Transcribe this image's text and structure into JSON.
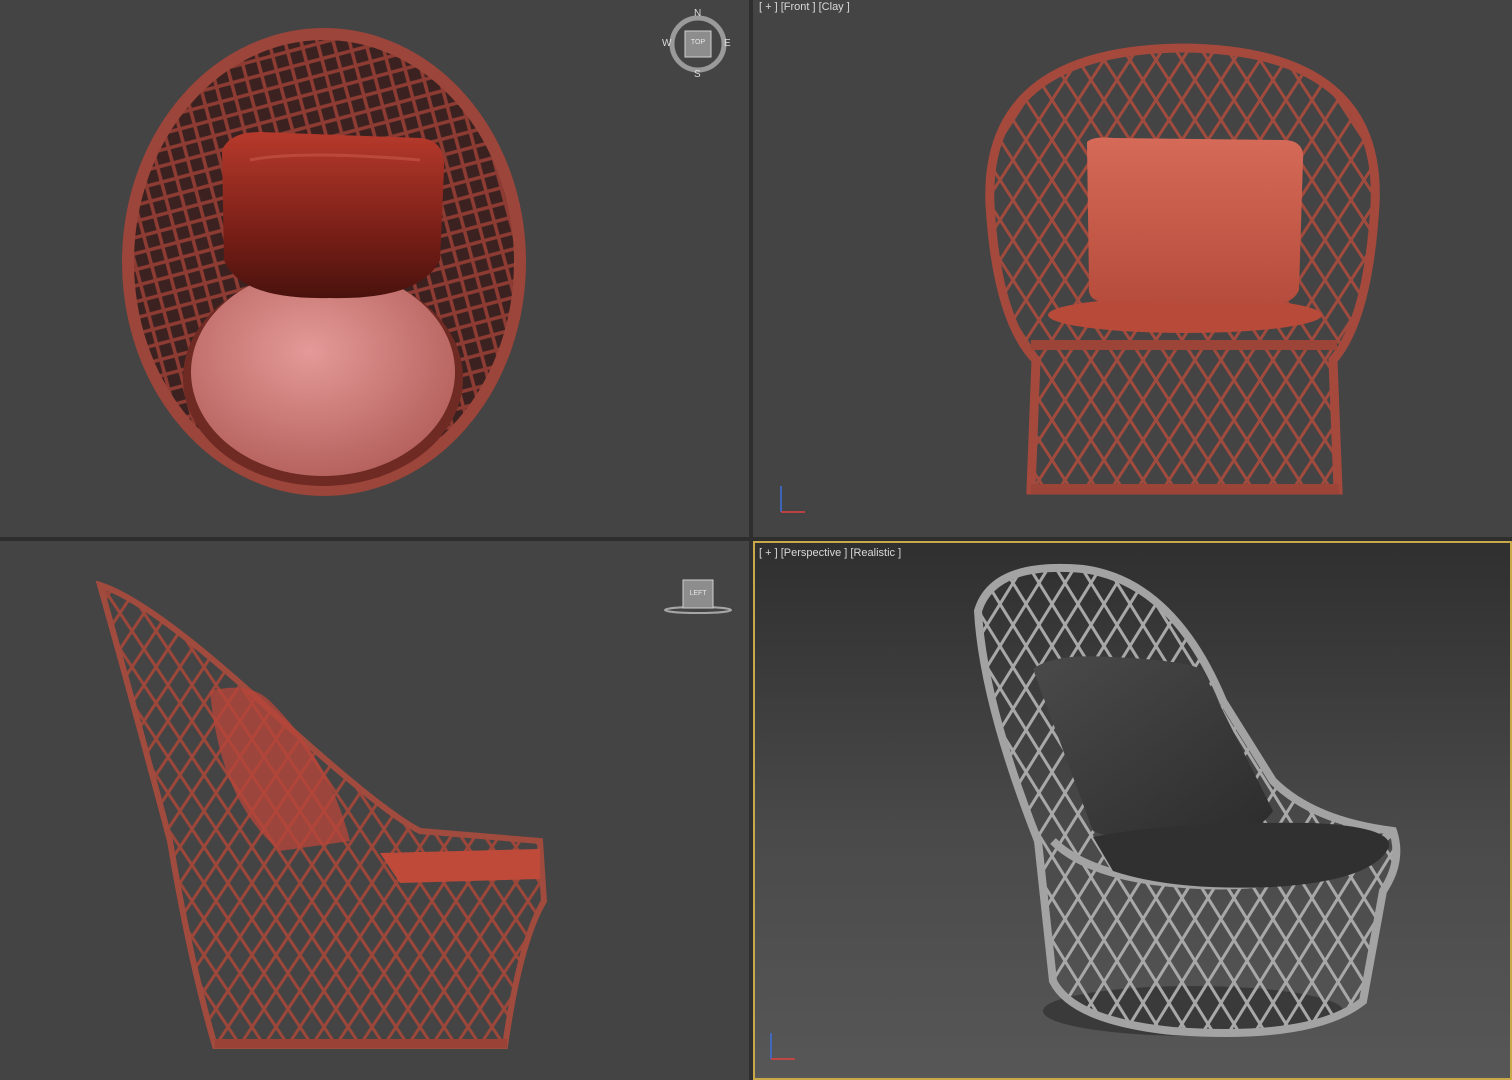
{
  "viewports": {
    "top": {
      "label": "",
      "viewcube_face": "TOP",
      "compass": {
        "n": "N",
        "s": "S",
        "e": "E",
        "w": "W"
      }
    },
    "front": {
      "label_plus": "[ + ]",
      "label_view": "[Front ]",
      "label_shading": "[Clay ]"
    },
    "left": {
      "label": "",
      "viewcube_face": "LEFT"
    },
    "perspective": {
      "label_plus": "[ + ]",
      "label_view": "[Perspective ]",
      "label_shading": "[Realistic ]",
      "active": true
    }
  },
  "colors": {
    "viewport_bg": "#444444",
    "wicker_clay": "#a34a3e",
    "cushion_clay": "#c85a4a",
    "seat_clay": "#cc7a78",
    "wicker_realistic": "#9a9a9a",
    "cushion_realistic": "#3a3a3a",
    "active_border": "#c9a84a"
  },
  "icons": [
    "viewcube-icon",
    "compass-icon",
    "axis-triad-icon"
  ]
}
